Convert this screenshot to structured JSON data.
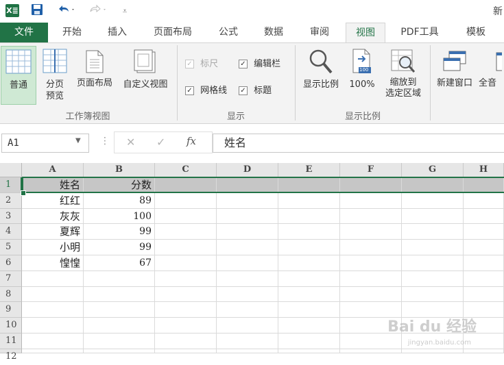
{
  "title": "新",
  "quick_access": {
    "excel_logo": "X≣",
    "save_icon": "save-icon",
    "undo_icon": "undo-icon",
    "redo_icon": "redo-icon",
    "customize_icon": "customize-icon"
  },
  "tabs": [
    {
      "label": "文件"
    },
    {
      "label": "开始"
    },
    {
      "label": "插入"
    },
    {
      "label": "页面布局"
    },
    {
      "label": "公式"
    },
    {
      "label": "数据"
    },
    {
      "label": "审阅"
    },
    {
      "label": "视图"
    },
    {
      "label": "PDF工具"
    },
    {
      "label": "模板"
    }
  ],
  "active_tab": "视图",
  "ribbon": {
    "workbook_views": {
      "group_label": "工作簿视图",
      "buttons": [
        {
          "label": "普通",
          "selected": true
        },
        {
          "label": "分页\n预览"
        },
        {
          "label": "页面布局"
        },
        {
          "label": "自定义视图"
        }
      ]
    },
    "show": {
      "group_label": "显示",
      "checkboxes": [
        {
          "label": "标尺",
          "checked": true,
          "disabled": true
        },
        {
          "label": "编辑栏",
          "checked": true
        },
        {
          "label": "网格线",
          "checked": true
        },
        {
          "label": "标题",
          "checked": true
        }
      ]
    },
    "zoom": {
      "group_label": "显示比例",
      "buttons": [
        {
          "label": "显示比例"
        },
        {
          "label": "100%"
        },
        {
          "label": "缩放到\n选定区域"
        }
      ],
      "badge": "100"
    },
    "window": {
      "buttons": [
        {
          "label": "新建窗口"
        },
        {
          "label": "全音"
        }
      ]
    }
  },
  "formula_bar": {
    "name_box": "A1",
    "cancel_icon": "✕",
    "enter_icon": "✓",
    "fx_label": "fx",
    "value": "姓名"
  },
  "sheet": {
    "columns": [
      "A",
      "B",
      "C",
      "D",
      "E",
      "F",
      "G",
      "H"
    ],
    "rows": [
      "1",
      "2",
      "3",
      "4",
      "5",
      "6",
      "7",
      "8",
      "9",
      "10",
      "11",
      "12"
    ],
    "cells": [
      [
        "姓名",
        "分数"
      ],
      [
        "红红",
        "89"
      ],
      [
        "灰灰",
        "100"
      ],
      [
        "夏辉",
        "99"
      ],
      [
        "小明",
        "99"
      ],
      [
        "惶惶",
        "67"
      ]
    ],
    "selected_row": "1"
  },
  "watermark": {
    "text": "Bai du 经验",
    "sub": "jingyan.baidu.com"
  }
}
